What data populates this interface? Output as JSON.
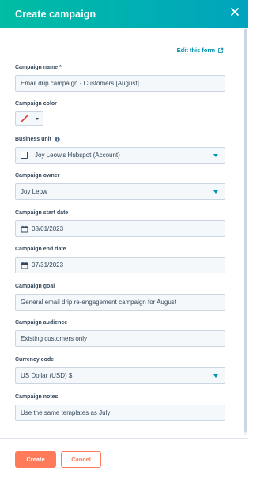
{
  "header": {
    "title": "Create campaign",
    "close_icon": "close-icon"
  },
  "edit_form": {
    "label": "Edit this form",
    "icon": "external-link-icon"
  },
  "fields": {
    "campaign_name": {
      "label": "Campaign name *",
      "value": "Email drip campaign - Customers [August]"
    },
    "campaign_color": {
      "label": "Campaign color",
      "swatch_color": "#e83a3a"
    },
    "business_unit": {
      "label": "Business unit",
      "info_icon": "info-icon",
      "value": "Joy Leow's Hubspot (Account)"
    },
    "campaign_owner": {
      "label": "Campaign owner",
      "value": "Joy Leow"
    },
    "start_date": {
      "label": "Campaign start date",
      "value": "08/01/2023"
    },
    "end_date": {
      "label": "Campaign end date",
      "value": "07/31/2023"
    },
    "campaign_goal": {
      "label": "Campaign goal",
      "value": "General email drip re-engagement campaign for August"
    },
    "campaign_audience": {
      "label": "Campaign audience",
      "value": "Existing customers only"
    },
    "currency_code": {
      "label": "Currency code",
      "value": "US Dollar (USD) $"
    },
    "campaign_notes": {
      "label": "Campaign notes",
      "value": "Use the same templates as July!"
    }
  },
  "footer": {
    "create_label": "Create",
    "cancel_label": "Cancel"
  },
  "colors": {
    "header_start": "#00bda5",
    "header_end": "#00a4bd",
    "primary": "#ff7a59",
    "link": "#0091ae"
  }
}
